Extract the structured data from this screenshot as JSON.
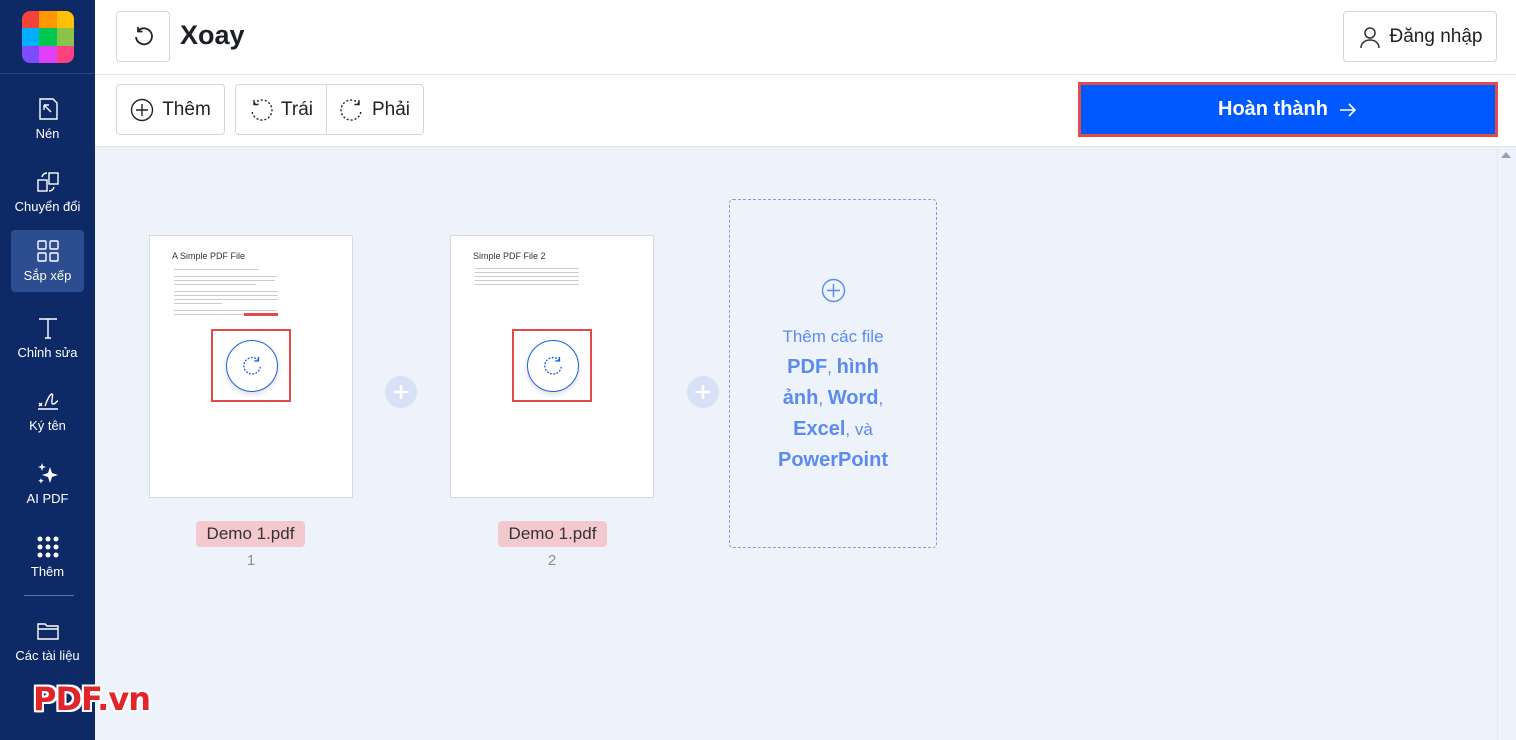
{
  "app": {
    "brand_colors": [
      "#f4433a",
      "#ff9800",
      "#ffc107",
      "#00b0ff",
      "#00c853",
      "#8bc34a",
      "#7c4dff",
      "#e040fb",
      "#ff4081"
    ],
    "watermark": "PDF.vn"
  },
  "sidebar": {
    "items": [
      {
        "label": "Nén",
        "icon": "compress-icon"
      },
      {
        "label": "Chuyển đổi",
        "icon": "convert-icon"
      },
      {
        "label": "Sắp xếp",
        "icon": "grid-icon",
        "active": true
      },
      {
        "label": "Chỉnh sửa",
        "icon": "text-edit-icon"
      },
      {
        "label": "Ký tên",
        "icon": "signature-icon"
      },
      {
        "label": "AI PDF",
        "icon": "sparkle-icon"
      },
      {
        "label": "Thêm",
        "icon": "dots-grid-icon"
      },
      {
        "label": "Các tài liệu",
        "icon": "folder-icon"
      }
    ]
  },
  "header": {
    "title": "Xoay",
    "login_label": "Đăng nhập"
  },
  "toolbar": {
    "add_label": "Thêm",
    "left_label": "Trái",
    "right_label": "Phải",
    "done_label": "Hoàn thành",
    "accent": "#0059ff"
  },
  "pages": [
    {
      "doc_title": "A Simple PDF File",
      "filename": "Demo 1.pdf",
      "number": "1"
    },
    {
      "doc_title": "Simple PDF File 2",
      "filename": "Demo 1.pdf",
      "number": "2"
    }
  ],
  "dropzone": {
    "line1": "Thêm các file",
    "pdf": "PDF",
    "sep1": ",",
    "image": "hình ảnh",
    "sep2": ",",
    "word": "Word",
    "sep3": ",",
    "excel": "Excel",
    "and": ", và",
    "ppt": "PowerPoint"
  }
}
